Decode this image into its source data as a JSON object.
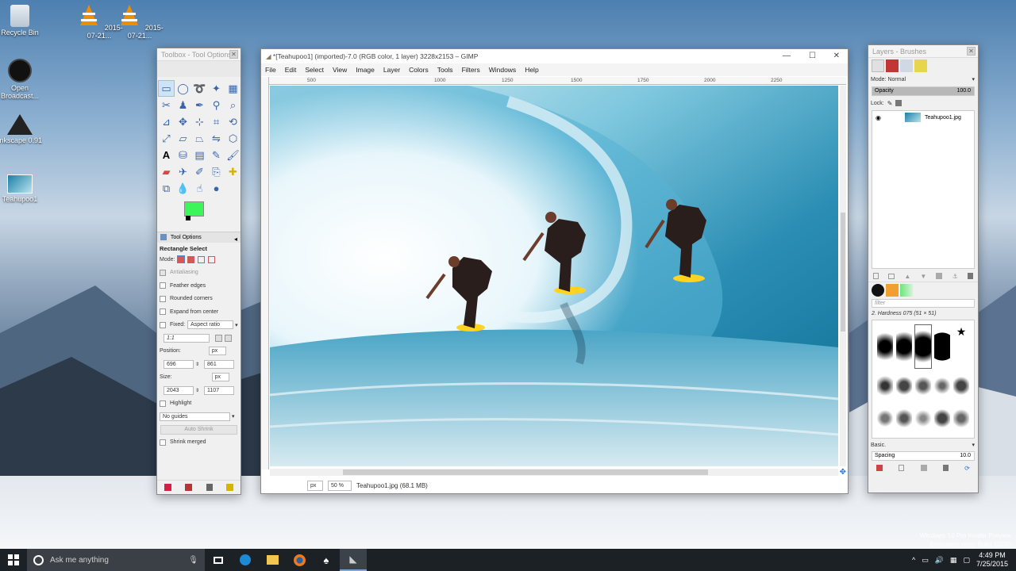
{
  "desktop": {
    "icons": [
      {
        "label": "Recycle Bin"
      },
      {
        "label": "2015-07-21..."
      },
      {
        "label": "2015-07-21..."
      },
      {
        "label": "Open Broadcast..."
      },
      {
        "label": "Inkscape 0.91"
      },
      {
        "label": "Teahupoo1"
      }
    ],
    "watermark_line1": "Windows 10 Pro Insider Preview",
    "watermark_line2": "Evaluation copy. Build 10240"
  },
  "toolbox": {
    "title": "Toolbox - Tool Options",
    "fg_color": "#3cf55a",
    "options_tab": "Tool Options",
    "tool_name": "Rectangle Select",
    "mode_label": "Mode:",
    "antialiasing": "Antialiasing",
    "feather_edges": "Feather edges",
    "rounded_corners": "Rounded corners",
    "expand_from_center": "Expand from center",
    "fixed_label": "Fixed:",
    "fixed_value": "Aspect ratio",
    "ratio_value": "1:1",
    "position_label": "Position:",
    "position_unit": "px",
    "position_x": "696",
    "position_y": "861",
    "size_label": "Size:",
    "size_unit": "px",
    "size_w": "2043",
    "size_h": "1107",
    "highlight": "Highlight",
    "guides_value": "No guides",
    "auto_shrink": "Auto Shrink",
    "shrink_merged": "Shrink merged"
  },
  "gimp": {
    "title": "*[Teahupoo1] (imported)-7.0 (RGB color, 1 layer) 3228x2153 – GIMP",
    "menus": [
      "File",
      "Edit",
      "Select",
      "View",
      "Image",
      "Layer",
      "Colors",
      "Tools",
      "Filters",
      "Windows",
      "Help"
    ],
    "ruler_ticks": [
      "500",
      "1000",
      "1250",
      "1500",
      "1750",
      "2000",
      "2250"
    ],
    "unit": "px",
    "zoom": "50 %",
    "status": "Teahupoo1.jpg (68.1 MB)"
  },
  "layers": {
    "title": "Layers - Brushes",
    "mode_label": "Mode:",
    "mode_value": "Normal",
    "opacity_label": "Opacity",
    "opacity_value": "100.0",
    "opacity_fraction": 1.0,
    "lock_label": "Lock:",
    "layer_name": "Teahupoo1.jpg",
    "filter_placeholder": "filter",
    "brush_name": "2. Hardness 075 (51 × 51)",
    "brush_preset": "Basic.",
    "spacing_label": "Spacing",
    "spacing_value": "10.0"
  },
  "taskbar": {
    "search_placeholder": "Ask me anything",
    "time": "4:49 PM",
    "date": "7/25/2015"
  }
}
